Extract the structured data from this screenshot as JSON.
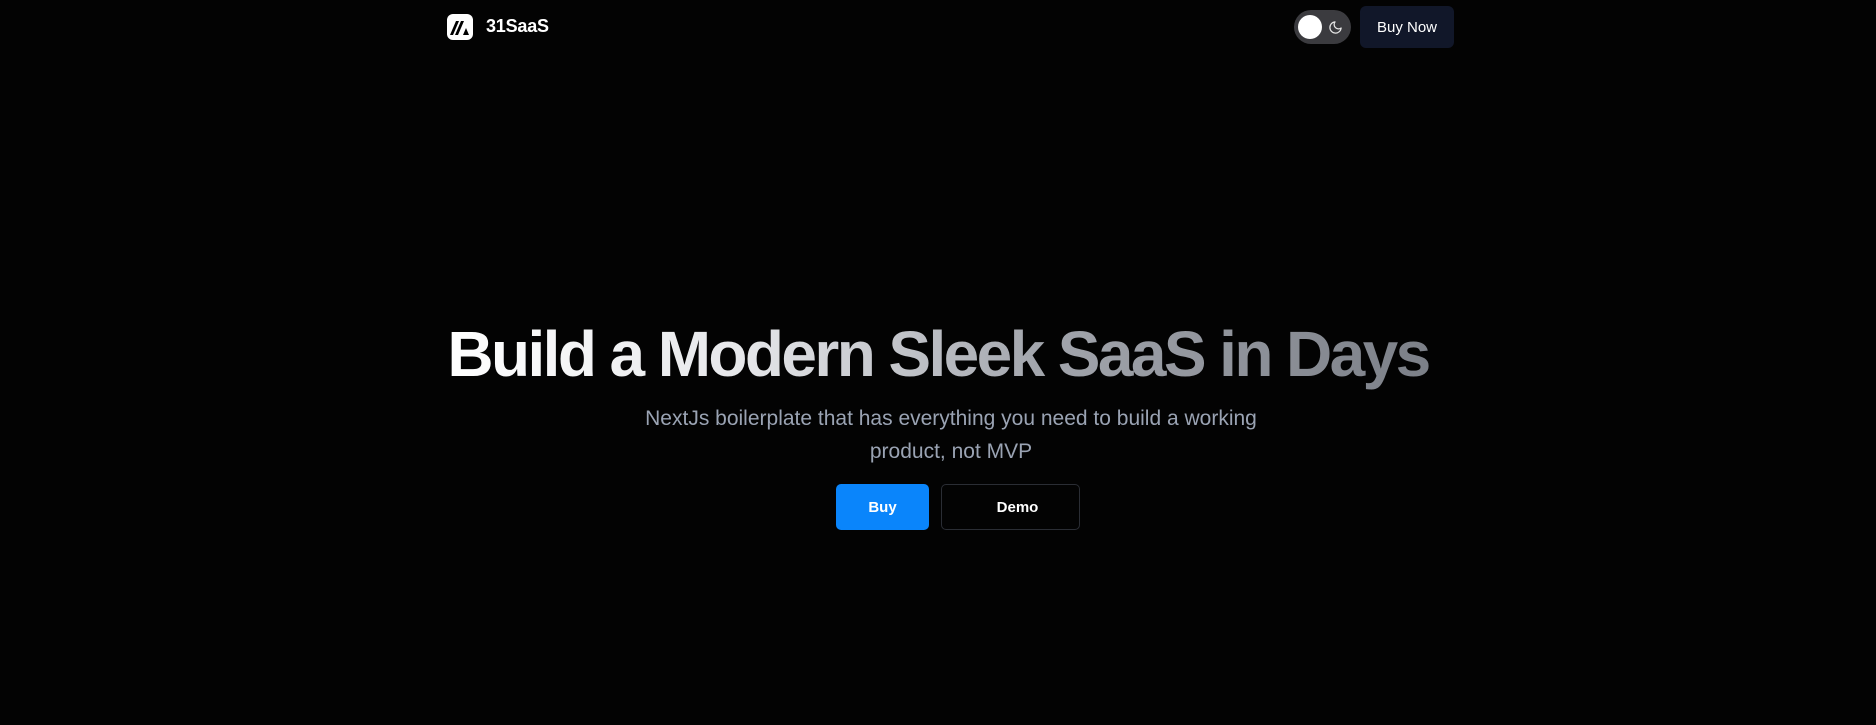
{
  "header": {
    "brand_name": "31SaaS",
    "buy_now_label": "Buy Now",
    "theme_toggle_state": "dark"
  },
  "hero": {
    "title": "Build a Modern Sleek SaaS in Days",
    "subtitle_line1": "NextJs boilerplate that has everything you need to build a working",
    "subtitle_line2": "product, not MVP",
    "buy_label": "Buy",
    "demo_label": "Demo"
  },
  "colors": {
    "background": "#030303",
    "primary_button": "#0a85fb",
    "buy_now_button": "#111729",
    "subtitle_text": "#9aa3b3"
  },
  "icons": {
    "brand_logo": "brand-logo-icon",
    "theme_toggle": "moon-icon"
  }
}
